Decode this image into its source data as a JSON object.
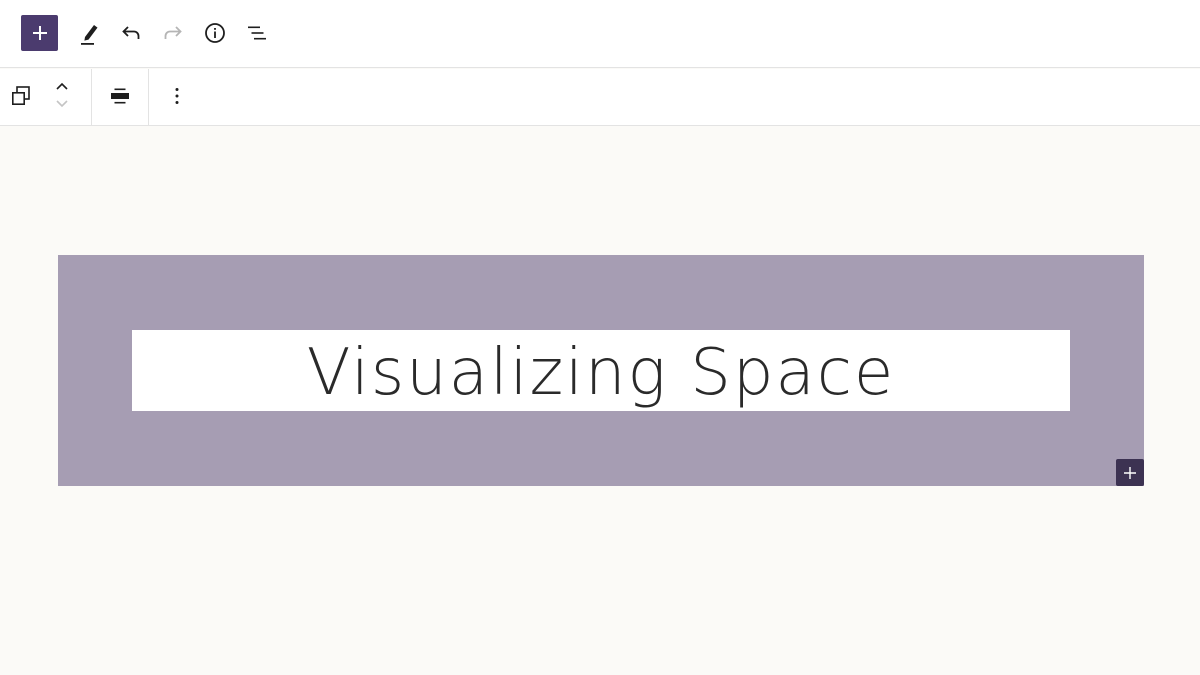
{
  "editor": {
    "top_toolbar": {
      "buttons": [
        {
          "name": "inserter",
          "icon": "plus-icon"
        },
        {
          "name": "tools",
          "icon": "pencil-icon"
        },
        {
          "name": "undo",
          "icon": "undo-icon"
        },
        {
          "name": "redo",
          "icon": "redo-icon",
          "disabled": true
        },
        {
          "name": "details",
          "icon": "info-icon"
        },
        {
          "name": "list-view",
          "icon": "list-view-icon"
        }
      ]
    },
    "block_toolbar": {
      "buttons": [
        {
          "name": "block-type",
          "icon": "cover-block-icon"
        },
        {
          "name": "move-up",
          "icon": "chevron-up-icon"
        },
        {
          "name": "move-down",
          "icon": "chevron-down-icon",
          "disabled": true
        },
        {
          "name": "align",
          "icon": "align-center-icon"
        },
        {
          "name": "options",
          "icon": "more-vertical-icon"
        }
      ]
    }
  },
  "canvas": {
    "cover": {
      "overlay_color": "#a69db3",
      "heading": "Visualizing Space"
    },
    "append_button_icon": "plus-icon"
  },
  "colors": {
    "accent": "#4b3b6e",
    "append_button": "#3c3252",
    "canvas_background": "#fbfaf7",
    "heading_text": "#2a2a2a"
  }
}
